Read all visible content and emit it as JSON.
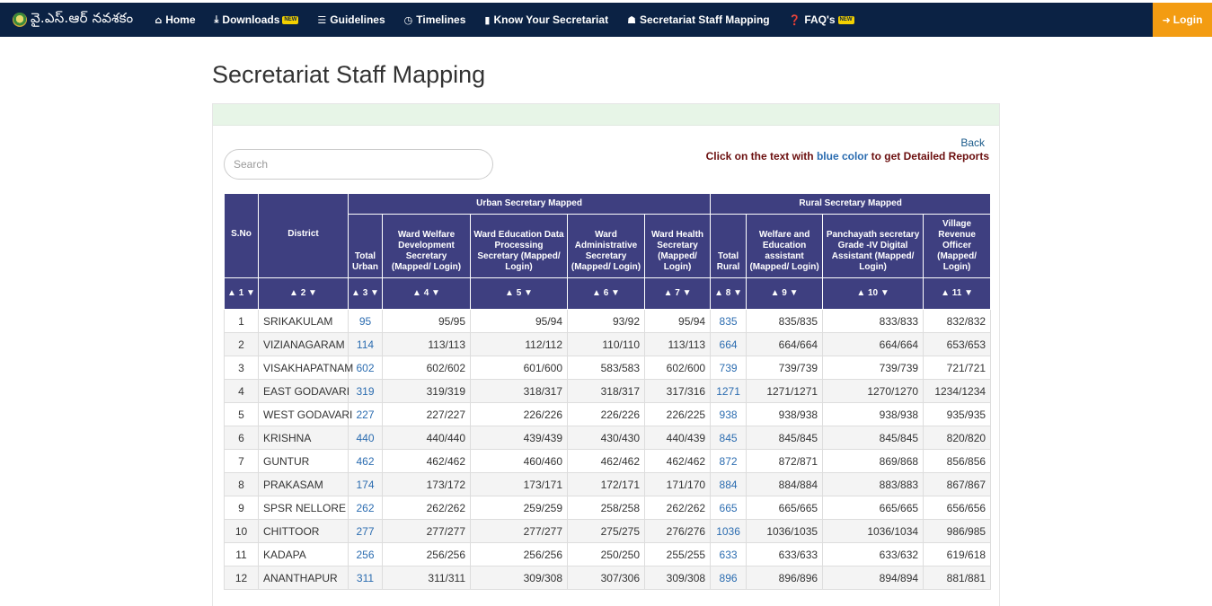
{
  "brand": {
    "title": "వై.ఎస్.ఆర్ నవశకం"
  },
  "nav": {
    "items": [
      {
        "icon": "home-icon",
        "label": "Home",
        "new": false
      },
      {
        "icon": "download-icon",
        "label": "Downloads",
        "new": true
      },
      {
        "icon": "list-icon",
        "label": "Guidelines",
        "new": false
      },
      {
        "icon": "clock-icon",
        "label": "Timelines",
        "new": false
      },
      {
        "icon": "book-icon",
        "label": "Know Your Secretariat",
        "new": false
      },
      {
        "icon": "users-icon",
        "label": "Secretariat Staff Mapping",
        "new": false
      },
      {
        "icon": "question-icon",
        "label": "FAQ's",
        "new": true
      }
    ],
    "new_badge": "NEW",
    "login_label": "Login"
  },
  "page": {
    "title": "Secretariat Staff Mapping",
    "search_placeholder": "Search",
    "back_label": "Back",
    "info_prefix": "Click on the text with ",
    "info_blue": "blue color",
    "info_suffix": " to get Detailed Reports"
  },
  "table": {
    "group_urban": "Urban Secretary Mapped",
    "group_rural": "Rural Secretary Mapped",
    "columns": [
      "S.No",
      "District",
      "Total Urban",
      "Ward Welfare Development Secretary (Mapped/ Login)",
      "Ward Education Data Processing Secretary (Mapped/ Login)",
      "Ward Administrative Secretary (Mapped/ Login)",
      "Ward Health Secretary (Mapped/ Login)",
      "Total Rural",
      "Welfare and Education assistant (Mapped/ Login)",
      "Panchayath secretary Grade -IV Digital Assistant (Mapped/ Login)",
      "Village Revenue Officer (Mapped/ Login)"
    ],
    "sort_labels": [
      "▲ 1 ▼",
      "▲ 2 ▼",
      "▲ 3 ▼",
      "▲ 4 ▼",
      "▲ 5 ▼",
      "▲ 6 ▼",
      "▲ 7 ▼",
      "▲ 8 ▼",
      "▲ 9 ▼",
      "▲ 10 ▼",
      "▲ 11 ▼"
    ],
    "rows": [
      [
        "1",
        "SRIKAKULAM",
        "95",
        "95/95",
        "95/94",
        "93/92",
        "95/94",
        "835",
        "835/835",
        "833/833",
        "832/832"
      ],
      [
        "2",
        "VIZIANAGARAM",
        "114",
        "113/113",
        "112/112",
        "110/110",
        "113/113",
        "664",
        "664/664",
        "664/664",
        "653/653"
      ],
      [
        "3",
        "VISAKHAPATNAM",
        "602",
        "602/602",
        "601/600",
        "583/583",
        "602/600",
        "739",
        "739/739",
        "739/739",
        "721/721"
      ],
      [
        "4",
        "EAST GODAVARI",
        "319",
        "319/319",
        "318/317",
        "318/317",
        "317/316",
        "1271",
        "1271/1271",
        "1270/1270",
        "1234/1234"
      ],
      [
        "5",
        "WEST GODAVARI",
        "227",
        "227/227",
        "226/226",
        "226/226",
        "226/225",
        "938",
        "938/938",
        "938/938",
        "935/935"
      ],
      [
        "6",
        "KRISHNA",
        "440",
        "440/440",
        "439/439",
        "430/430",
        "440/439",
        "845",
        "845/845",
        "845/845",
        "820/820"
      ],
      [
        "7",
        "GUNTUR",
        "462",
        "462/462",
        "460/460",
        "462/462",
        "462/462",
        "872",
        "872/871",
        "869/868",
        "856/856"
      ],
      [
        "8",
        "PRAKASAM",
        "174",
        "173/172",
        "173/171",
        "172/171",
        "171/170",
        "884",
        "884/884",
        "883/883",
        "867/867"
      ],
      [
        "9",
        "SPSR NELLORE",
        "262",
        "262/262",
        "259/259",
        "258/258",
        "262/262",
        "665",
        "665/665",
        "665/665",
        "656/656"
      ],
      [
        "10",
        "CHITTOOR",
        "277",
        "277/277",
        "277/277",
        "275/275",
        "276/276",
        "1036",
        "1036/1035",
        "1036/1034",
        "986/985"
      ],
      [
        "11",
        "KADAPA",
        "256",
        "256/256",
        "256/256",
        "250/250",
        "255/255",
        "633",
        "633/633",
        "633/632",
        "619/618"
      ],
      [
        "12",
        "ANANTHAPUR",
        "311",
        "311/311",
        "309/308",
        "307/306",
        "309/308",
        "896",
        "896/896",
        "894/894",
        "881/881"
      ]
    ]
  }
}
